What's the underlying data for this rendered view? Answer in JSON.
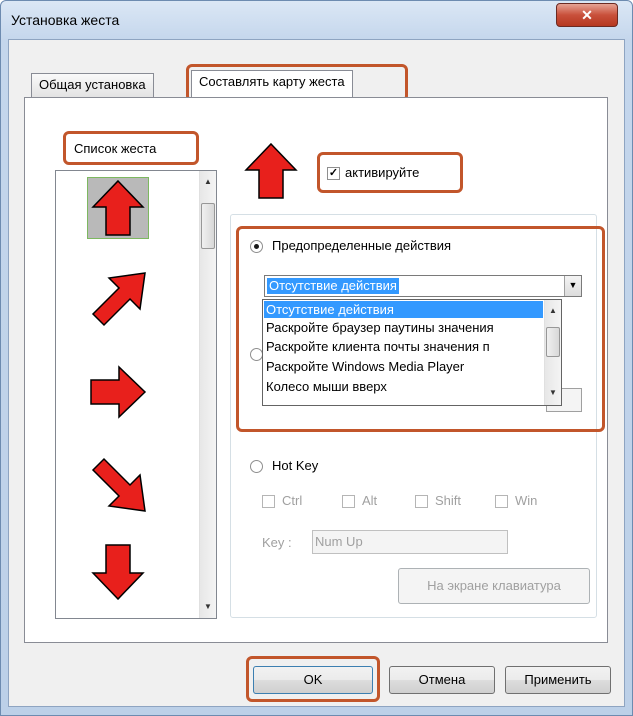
{
  "window": {
    "title": "Установка жеста",
    "close_glyph": "✕"
  },
  "tabs": [
    {
      "label": "Общая установка",
      "active": false
    },
    {
      "label": "Составлять карту жеста",
      "active": true
    }
  ],
  "gesture_list": {
    "label": "Список жеста",
    "items": [
      {
        "name": "arrow-up-icon",
        "direction": "up",
        "selected": true
      },
      {
        "name": "arrow-up-right-icon",
        "direction": "up-right",
        "selected": false
      },
      {
        "name": "arrow-right-icon",
        "direction": "right",
        "selected": false
      },
      {
        "name": "arrow-down-right-icon",
        "direction": "down-right",
        "selected": false
      },
      {
        "name": "arrow-down-icon",
        "direction": "down",
        "selected": false
      }
    ]
  },
  "preview": {
    "icon": "arrow-up-icon"
  },
  "activate": {
    "label": "активируйте",
    "checked": true,
    "check_glyph": "✓"
  },
  "predefined": {
    "label": "Предопределенные действия",
    "selected": true,
    "combo_value": "Отсутствие действия",
    "options": [
      "Отсутствие действия",
      "Раскройте браузер паутины значения",
      "Раскройте клиента почты значения п",
      "Раскройте Windows Media Player",
      "Колесо мыши вверх"
    ]
  },
  "hotkey": {
    "label": "Hot Key",
    "selected": false,
    "modifiers": [
      "Ctrl",
      "Alt",
      "Shift",
      "Win"
    ],
    "key_label": "Key :",
    "key_value": "Num Up",
    "onscreen_keyboard_label": "На экране клавиатура"
  },
  "buttons": {
    "ok": "OK",
    "cancel": "Отмена",
    "apply": "Применить"
  },
  "colors": {
    "highlight": "#c2562b",
    "arrow_fill": "#e8201c",
    "selection": "#3399ff"
  }
}
